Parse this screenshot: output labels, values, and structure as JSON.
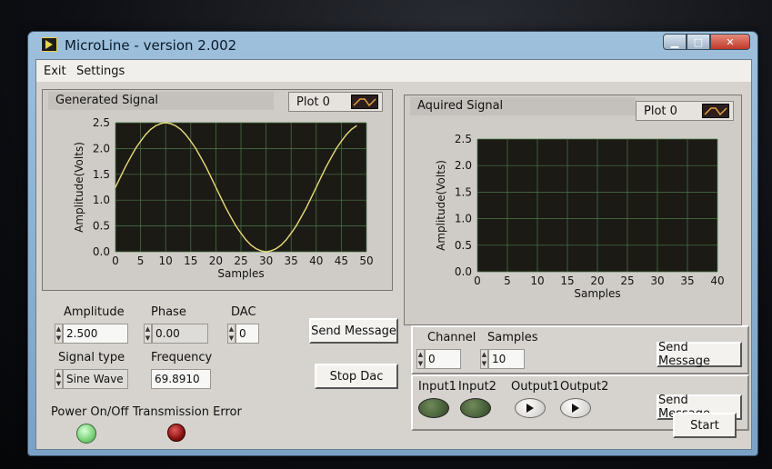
{
  "window": {
    "title": "MicroLine - version 2.002"
  },
  "menu": {
    "items": [
      "Exit",
      "Settings"
    ]
  },
  "colors": {
    "plot_bg": "#1c1a15",
    "grid": "#4a7a4a",
    "trace": "#e8dc78",
    "led_green_on": "#8fe08f",
    "led_green_off": "#3c5a30",
    "led_red": "#8a1010"
  },
  "generated": {
    "label": "Generated Signal",
    "legend": "Plot 0",
    "chart_data": {
      "type": "line",
      "x": [
        0,
        1,
        2,
        3,
        4,
        5,
        6,
        7,
        8,
        9,
        10,
        11,
        12,
        13,
        14,
        15,
        16,
        17,
        18,
        19,
        20,
        21,
        22,
        23,
        24,
        25,
        26,
        27,
        28,
        29,
        30,
        31,
        32,
        33,
        34,
        35,
        36,
        37,
        38,
        39,
        40,
        41,
        42,
        43,
        44,
        45,
        46,
        47,
        48
      ],
      "y": [
        1.25,
        1.45,
        1.65,
        1.83,
        2.0,
        2.14,
        2.27,
        2.37,
        2.44,
        2.48,
        2.5,
        2.48,
        2.44,
        2.37,
        2.27,
        2.14,
        2.0,
        1.83,
        1.65,
        1.45,
        1.25,
        1.05,
        0.85,
        0.67,
        0.5,
        0.36,
        0.23,
        0.13,
        0.06,
        0.02,
        0.0,
        0.02,
        0.06,
        0.13,
        0.23,
        0.36,
        0.5,
        0.67,
        0.85,
        1.05,
        1.25,
        1.45,
        1.65,
        1.83,
        2.0,
        2.14,
        2.27,
        2.37,
        2.44
      ],
      "xlabel": "Samples",
      "ylabel": "Amplitude(Volts)",
      "xlim": [
        0,
        50
      ],
      "ylim": [
        0,
        2.5
      ],
      "xticks": [
        "0",
        "5",
        "10",
        "15",
        "20",
        "25",
        "30",
        "35",
        "40",
        "45",
        "50"
      ],
      "yticks": [
        "0.0",
        "0.5",
        "1.0",
        "1.5",
        "2.0",
        "2.5"
      ],
      "grid": true
    }
  },
  "acquired": {
    "label": "Aquired Signal",
    "legend": "Plot 0",
    "chart_data": {
      "type": "line",
      "x": [],
      "y": [],
      "xlabel": "Samples",
      "ylabel": "Amplitude(Volts)",
      "xlim": [
        0,
        40
      ],
      "ylim": [
        0,
        2.5
      ],
      "xticks": [
        "0",
        "5",
        "10",
        "15",
        "20",
        "25",
        "30",
        "35",
        "40"
      ],
      "yticks": [
        "0.0",
        "0.5",
        "1.0",
        "1.5",
        "2.0",
        "2.5"
      ],
      "grid": true
    }
  },
  "controls": {
    "amplitude": {
      "label": "Amplitude",
      "value": "2.500"
    },
    "phase": {
      "label": "Phase",
      "value": "0.00"
    },
    "dac": {
      "label": "DAC",
      "value": "0"
    },
    "signal_type": {
      "label": "Signal type",
      "value": "Sine Wave"
    },
    "frequency": {
      "label": "Frequency",
      "value": "69.8910"
    },
    "send_message": "Send Message",
    "stop_dac": "Stop Dac"
  },
  "acq_controls": {
    "channel": {
      "label": "Channel",
      "value": "0"
    },
    "samples": {
      "label": "Samples",
      "value": "10"
    },
    "send_message": "Send Message"
  },
  "io": {
    "input1": "Input1",
    "input2": "Input2",
    "output1": "Output1",
    "output2": "Output2",
    "send_message": "Send Message"
  },
  "status": {
    "power_label": "Power On/Off",
    "error_label": "Transmission Error",
    "start": "Start"
  }
}
